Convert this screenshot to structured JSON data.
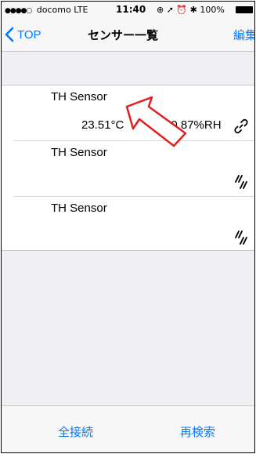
{
  "status_bar": {
    "signal": "●●●●○",
    "carrier": "docomo",
    "network": "LTE",
    "time": "11:40",
    "indicators": "⊕ ➚ ⏰ ✱",
    "battery": "100%"
  },
  "nav": {
    "back_label": "TOP",
    "title": "センサー一覧",
    "edit_label": "編集"
  },
  "sensors": [
    {
      "name": "TH Sensor",
      "temperature": "23.51°C",
      "humidity": "30.87%RH",
      "icon": "link-icon"
    },
    {
      "name": "TH Sensor",
      "temperature": "",
      "humidity": "",
      "icon": "unlink-icon"
    },
    {
      "name": "TH Sensor",
      "temperature": "",
      "humidity": "",
      "icon": "unlink-icon"
    }
  ],
  "toolbar": {
    "connect_all_label": "全接続",
    "rescan_label": "再検索"
  },
  "colors": {
    "accent": "#007aff",
    "annotation": "#e02020",
    "background": "#efeff4"
  }
}
